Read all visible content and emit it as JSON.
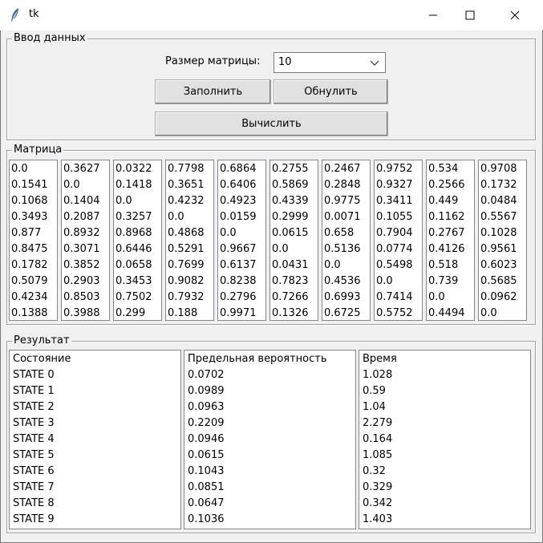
{
  "window": {
    "title": "tk",
    "icon": "feather-icon",
    "controls": [
      "minimize-icon",
      "maximize-icon",
      "close-icon"
    ]
  },
  "input_frame": {
    "legend": "Ввод данных",
    "size_label": "Размер матрицы:",
    "size_value": "10",
    "fill_button": "Заполнить",
    "reset_button": "Обнулить",
    "calc_button": "Вычислить"
  },
  "matrix_frame": {
    "legend": "Матрица",
    "columns": [
      [
        "0.0",
        "0.1541",
        "0.1068",
        "0.3493",
        "0.877",
        "0.8475",
        "0.1782",
        "0.5079",
        "0.4234",
        "0.1388"
      ],
      [
        "0.3627",
        "0.0",
        "0.1404",
        "0.2087",
        "0.8932",
        "0.3071",
        "0.3852",
        "0.2903",
        "0.8503",
        "0.3988"
      ],
      [
        "0.0322",
        "0.1418",
        "0.0",
        "0.3257",
        "0.8968",
        "0.6446",
        "0.0658",
        "0.3453",
        "0.7502",
        "0.299"
      ],
      [
        "0.7798",
        "0.3651",
        "0.4232",
        "0.0",
        "0.4868",
        "0.5291",
        "0.7699",
        "0.9082",
        "0.7932",
        "0.188"
      ],
      [
        "0.6864",
        "0.6406",
        "0.4923",
        "0.0159",
        "0.0",
        "0.9667",
        "0.6137",
        "0.8238",
        "0.2796",
        "0.9971"
      ],
      [
        "0.2755",
        "0.5869",
        "0.4339",
        "0.2999",
        "0.0615",
        "0.0",
        "0.0431",
        "0.7823",
        "0.7266",
        "0.1326"
      ],
      [
        "0.2467",
        "0.2848",
        "0.9775",
        "0.0071",
        "0.658",
        "0.5136",
        "0.0",
        "0.4536",
        "0.6993",
        "0.6725"
      ],
      [
        "0.9752",
        "0.9327",
        "0.3411",
        "0.1055",
        "0.7904",
        "0.0774",
        "0.5498",
        "0.0",
        "0.7414",
        "0.5752"
      ],
      [
        "0.534",
        "0.2566",
        "0.449",
        "0.1162",
        "0.2767",
        "0.4126",
        "0.518",
        "0.739",
        "0.0",
        "0.4494"
      ],
      [
        "0.9708",
        "0.1732",
        "0.0484",
        "0.5567",
        "0.1028",
        "0.9561",
        "0.6023",
        "0.5685",
        "0.0962",
        "0.0"
      ]
    ]
  },
  "result_frame": {
    "legend": "Результат",
    "headers": [
      "Состояние",
      "Предельная вероятность",
      "Время"
    ],
    "states": [
      "STATE 0",
      "STATE 1",
      "STATE 2",
      "STATE 3",
      "STATE 4",
      "STATE 5",
      "STATE 6",
      "STATE 7",
      "STATE 8",
      "STATE 9"
    ],
    "probabilities": [
      "0.0702",
      "0.0989",
      "0.0963",
      "0.2209",
      "0.0946",
      "0.0615",
      "0.1043",
      "0.0851",
      "0.0647",
      "0.1036"
    ],
    "times": [
      "1.028",
      "0.59",
      "1.04",
      "2.279",
      "0.164",
      "1.085",
      "0.32",
      "0.329",
      "0.342",
      "1.403"
    ]
  }
}
